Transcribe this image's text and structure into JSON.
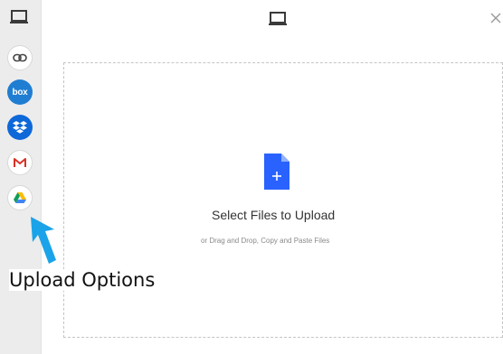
{
  "sidebar": {
    "top_icon": "laptop-icon",
    "sources": [
      {
        "name": "link",
        "icon": "link-icon"
      },
      {
        "name": "box",
        "icon": "box-icon",
        "label": "box"
      },
      {
        "name": "dropbox",
        "icon": "dropbox-icon"
      },
      {
        "name": "gmail",
        "icon": "gmail-icon"
      },
      {
        "name": "google-drive",
        "icon": "google-drive-icon"
      }
    ]
  },
  "header": {
    "device_icon": "laptop-icon",
    "close_icon": "close-icon"
  },
  "dropzone": {
    "title": "Select Files to Upload",
    "subtitle": "or Drag and Drop, Copy and Paste Files",
    "icon": "file-plus-icon"
  },
  "annotation": {
    "label": "Upload Options",
    "arrow_icon": "arrow-up-icon",
    "arrow_color": "#1aa3e8"
  },
  "colors": {
    "accent": "#2962ff",
    "box": "#1f7dd2",
    "dropbox": "#0f68d8",
    "sidebar_bg": "#ececec"
  }
}
